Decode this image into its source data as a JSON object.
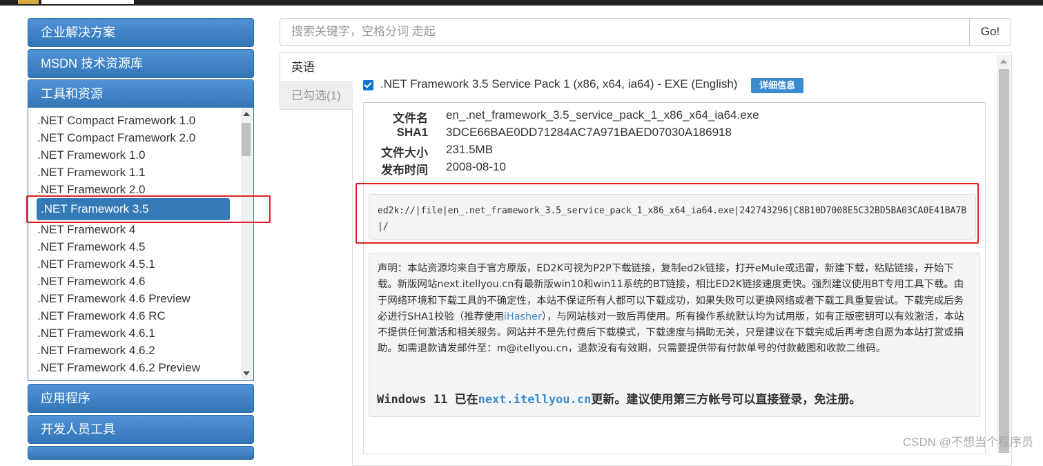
{
  "sidebar": {
    "sections": [
      {
        "label": "企业解决方案"
      },
      {
        "label": "MSDN 技术资源库"
      },
      {
        "label": "工具和资源"
      },
      {
        "label": "应用程序"
      },
      {
        "label": "开发人员工具"
      }
    ],
    "tree_items": [
      ".NET Compact Framework 1.0",
      ".NET Compact Framework 2.0",
      ".NET Framework 1.0",
      ".NET Framework 1.1",
      ".NET Framework 2.0",
      ".NET Framework 3.5",
      ".NET Framework 4",
      ".NET Framework 4.5",
      ".NET Framework 4.5.1",
      ".NET Framework 4.6",
      ".NET Framework 4.6 Preview",
      ".NET Framework 4.6 RC",
      ".NET Framework 4.6.1",
      ".NET Framework 4.6.2",
      ".NET Framework 4.6.2 Preview"
    ],
    "selected_index": 5
  },
  "search": {
    "placeholder": "搜索关键字，空格分词 走起",
    "button_label": "Go!"
  },
  "tabs": [
    {
      "label": "英语"
    },
    {
      "label": "已勾选(1)"
    }
  ],
  "product": {
    "title": ".NET Framework 3.5 Service Pack 1 (x86, x64, ia64) - EXE (English)",
    "detail_label": "详细信息",
    "checked": true
  },
  "info": {
    "filename_label": "文件名",
    "filename": "en_.net_framework_3.5_service_pack_1_x86_x64_ia64.exe",
    "sha1_label": "SHA1",
    "sha1": "3DCE66BAE0DD71284AC7A971BAED07030A186918",
    "size_label": "文件大小",
    "size": "231.5MB",
    "date_label": "发布时间",
    "date": "2008-08-10"
  },
  "ed2k": "ed2k://|file|en_.net_framework_3.5_service_pack_1_x86_x64_ia64.exe|242743296|C8B10D7008E5C32BD5BA03CA0E41BA7B|/",
  "notice": {
    "text_1": "声明：本站资源均来自于官方原版，ED2K可视为P2P下载链接，复制ed2k链接，打开eMule或迅雷，新建下载，粘贴链接，开始下载。新版网站next.itellyou.cn有最新版win10和win11系统的BT链接，相比ED2K链接速度更快。强烈建议使用BT专用工具下载。由于网络环境和下载工具的不确定性，本站不保证所有人都可以下载成功，如果失败可以更换网络或者下载工具重复尝试。下载完成后务必进行SHA1校验（推荐使用",
    "link_ihasher": "iHasher",
    "text_2": "），与网站核对一致后再使用。所有操作系统默认均为试用版，如有正版密钥可以有效激活，本站不提供任何激活和相关服务。网站并不是先付费后下载模式，下载速度与捐助无关，只是建议在下载完成后再考虑自愿为本站打赏或捐助。如需退款请发邮件至：m@itellyou.cn，退款没有有效期，只需要提供带有付款单号的付款截图和收款二维码。",
    "win11_prefix": "Windows 11 已在",
    "win11_link": "next.itellyou.cn",
    "win11_suffix": "更新。建议使用第三方帐号可以直接登录，免注册。"
  },
  "watermark": "CSDN @不想当个程序员"
}
